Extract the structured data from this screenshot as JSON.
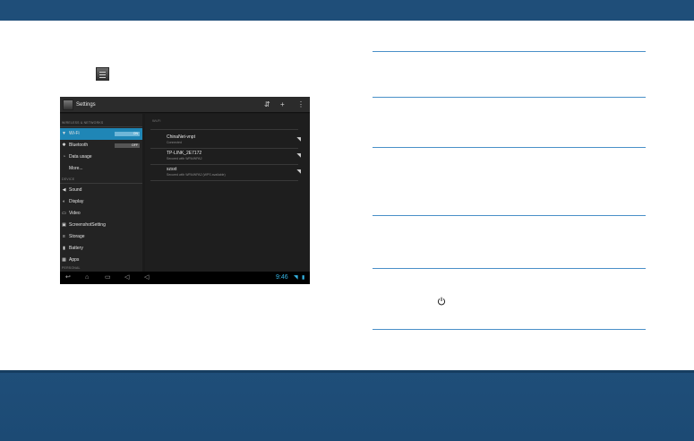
{
  "tablet": {
    "title": "Settings",
    "left_panel": {
      "sections": [
        {
          "header": "WIRELESS & NETWORKS"
        },
        {
          "header": "DEVICE"
        },
        {
          "header": "PERSONAL"
        }
      ],
      "items": [
        {
          "label": "Wi-Fi",
          "toggle": "ON",
          "icon": "wifi-icon",
          "selected": true
        },
        {
          "label": "Bluetooth",
          "toggle": "OFF",
          "icon": "bluetooth-icon"
        },
        {
          "label": "Data usage",
          "icon": "data-usage-icon"
        },
        {
          "label": "More...",
          "icon": ""
        },
        {
          "label": "Sound",
          "icon": "sound-icon"
        },
        {
          "label": "Display",
          "icon": "display-icon"
        },
        {
          "label": "Video",
          "icon": "video-icon"
        },
        {
          "label": "ScreenshotSetting",
          "icon": "screenshot-icon"
        },
        {
          "label": "Storage",
          "icon": "storage-icon"
        },
        {
          "label": "Battery",
          "icon": "battery-icon"
        },
        {
          "label": "Apps",
          "icon": "apps-icon"
        }
      ]
    },
    "right_panel": {
      "header": "Wi-Fi",
      "networks": [
        {
          "name": "ChinaNet-vnpt",
          "status": "Connected"
        },
        {
          "name": "TP-LINK_2E7172",
          "status": "Secured with WPA/WPA2"
        },
        {
          "name": "szsxt",
          "status": "Secured with WPA/WPA2 (WPS available)"
        }
      ]
    },
    "status_bar": {
      "clock": "9:46"
    }
  },
  "colors": {
    "brand_blue": "#1f4e79",
    "rule_blue": "#4a90c8",
    "holo_blue": "#35b5e5",
    "selected_blue": "#1f86b6"
  }
}
